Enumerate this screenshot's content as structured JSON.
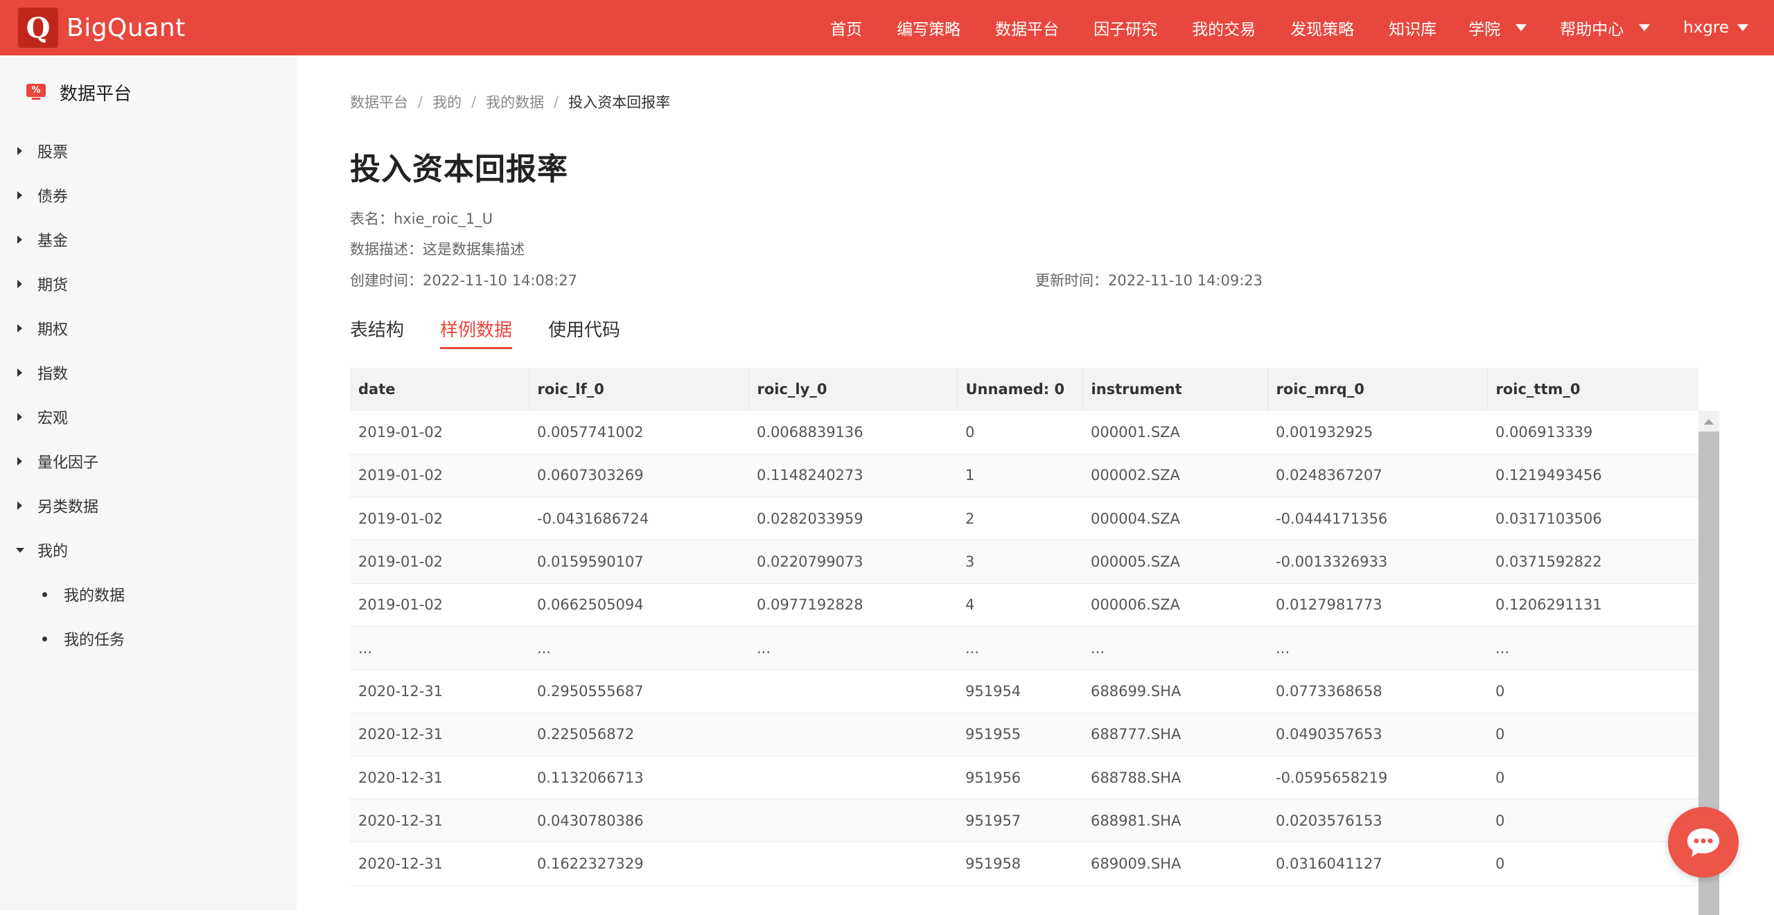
{
  "app": {
    "brand_mark": "Q",
    "brand_name": "BigQuant"
  },
  "topnav": {
    "items": [
      "首页",
      "编写策略",
      "数据平台",
      "因子研究",
      "我的交易",
      "发现策略",
      "知识库",
      "学院",
      "帮助中心",
      "hxgre"
    ]
  },
  "sidebar": {
    "title": "数据平台",
    "items": [
      "股票",
      "债券",
      "基金",
      "期货",
      "期权",
      "指数",
      "宏观",
      "量化因子",
      "另类数据",
      "我的"
    ],
    "sub_items": [
      "我的数据",
      "我的任务"
    ]
  },
  "breadcrumb": [
    "数据平台",
    "我的",
    "我的数据",
    "投入资本回报率"
  ],
  "page": {
    "title": "投入资本回报率",
    "table_name_label": "表名：",
    "table_name": "hxie_roic_1_U",
    "description_label": "数据描述：",
    "description": "这是数据集描述",
    "created_label": "创建时间：",
    "created": "2022-11-10 14:08:27",
    "updated_label": "更新时间：",
    "updated": "2022-11-10 14:09:23"
  },
  "tabs": [
    "表结构",
    "样例数据",
    "使用代码"
  ],
  "table": {
    "columns": [
      "date",
      "roic_lf_0",
      "roic_ly_0",
      "Unnamed: 0",
      "instrument",
      "roic_mrq_0",
      "roic_ttm_0"
    ],
    "rows": [
      [
        "2019-01-02",
        "0.0057741002",
        "0.0068839136",
        "0",
        "000001.SZA",
        "0.001932925",
        "0.006913339"
      ],
      [
        "2019-01-02",
        "0.0607303269",
        "0.1148240273",
        "1",
        "000002.SZA",
        "0.0248367207",
        "0.1219493456"
      ],
      [
        "2019-01-02",
        "-0.0431686724",
        "0.0282033959",
        "2",
        "000004.SZA",
        "-0.0444171356",
        "0.0317103506"
      ],
      [
        "2019-01-02",
        "0.0159590107",
        "0.0220799073",
        "3",
        "000005.SZA",
        "-0.0013326933",
        "0.0371592822"
      ],
      [
        "2019-01-02",
        "0.0662505094",
        "0.0977192828",
        "4",
        "000006.SZA",
        "0.0127981773",
        "0.1206291131"
      ],
      [
        "...",
        "...",
        "...",
        "...",
        "...",
        "...",
        "..."
      ],
      [
        "2020-12-31",
        "0.2950555687",
        "",
        "951954",
        "688699.SHA",
        "0.0773368658",
        "0"
      ],
      [
        "2020-12-31",
        "0.225056872",
        "",
        "951955",
        "688777.SHA",
        "0.0490357653",
        "0"
      ],
      [
        "2020-12-31",
        "0.1132066713",
        "",
        "951956",
        "688788.SHA",
        "-0.0595658219",
        "0"
      ],
      [
        "2020-12-31",
        "0.0430780386",
        "",
        "951957",
        "688981.SHA",
        "0.0203576153",
        "0"
      ],
      [
        "2020-12-31",
        "0.1622327329",
        "",
        "951958",
        "689009.SHA",
        "0.0316041127",
        "0"
      ]
    ]
  },
  "colors": {
    "brand": "#e8473d",
    "brand_dark": "#c0261c",
    "sidebar_bg": "#f7f7f7",
    "table_header_bg": "#f3f3f3"
  },
  "icons": {
    "sidebar_logo": "monitor-percent-icon",
    "chat": "chat-bubble-icon"
  }
}
